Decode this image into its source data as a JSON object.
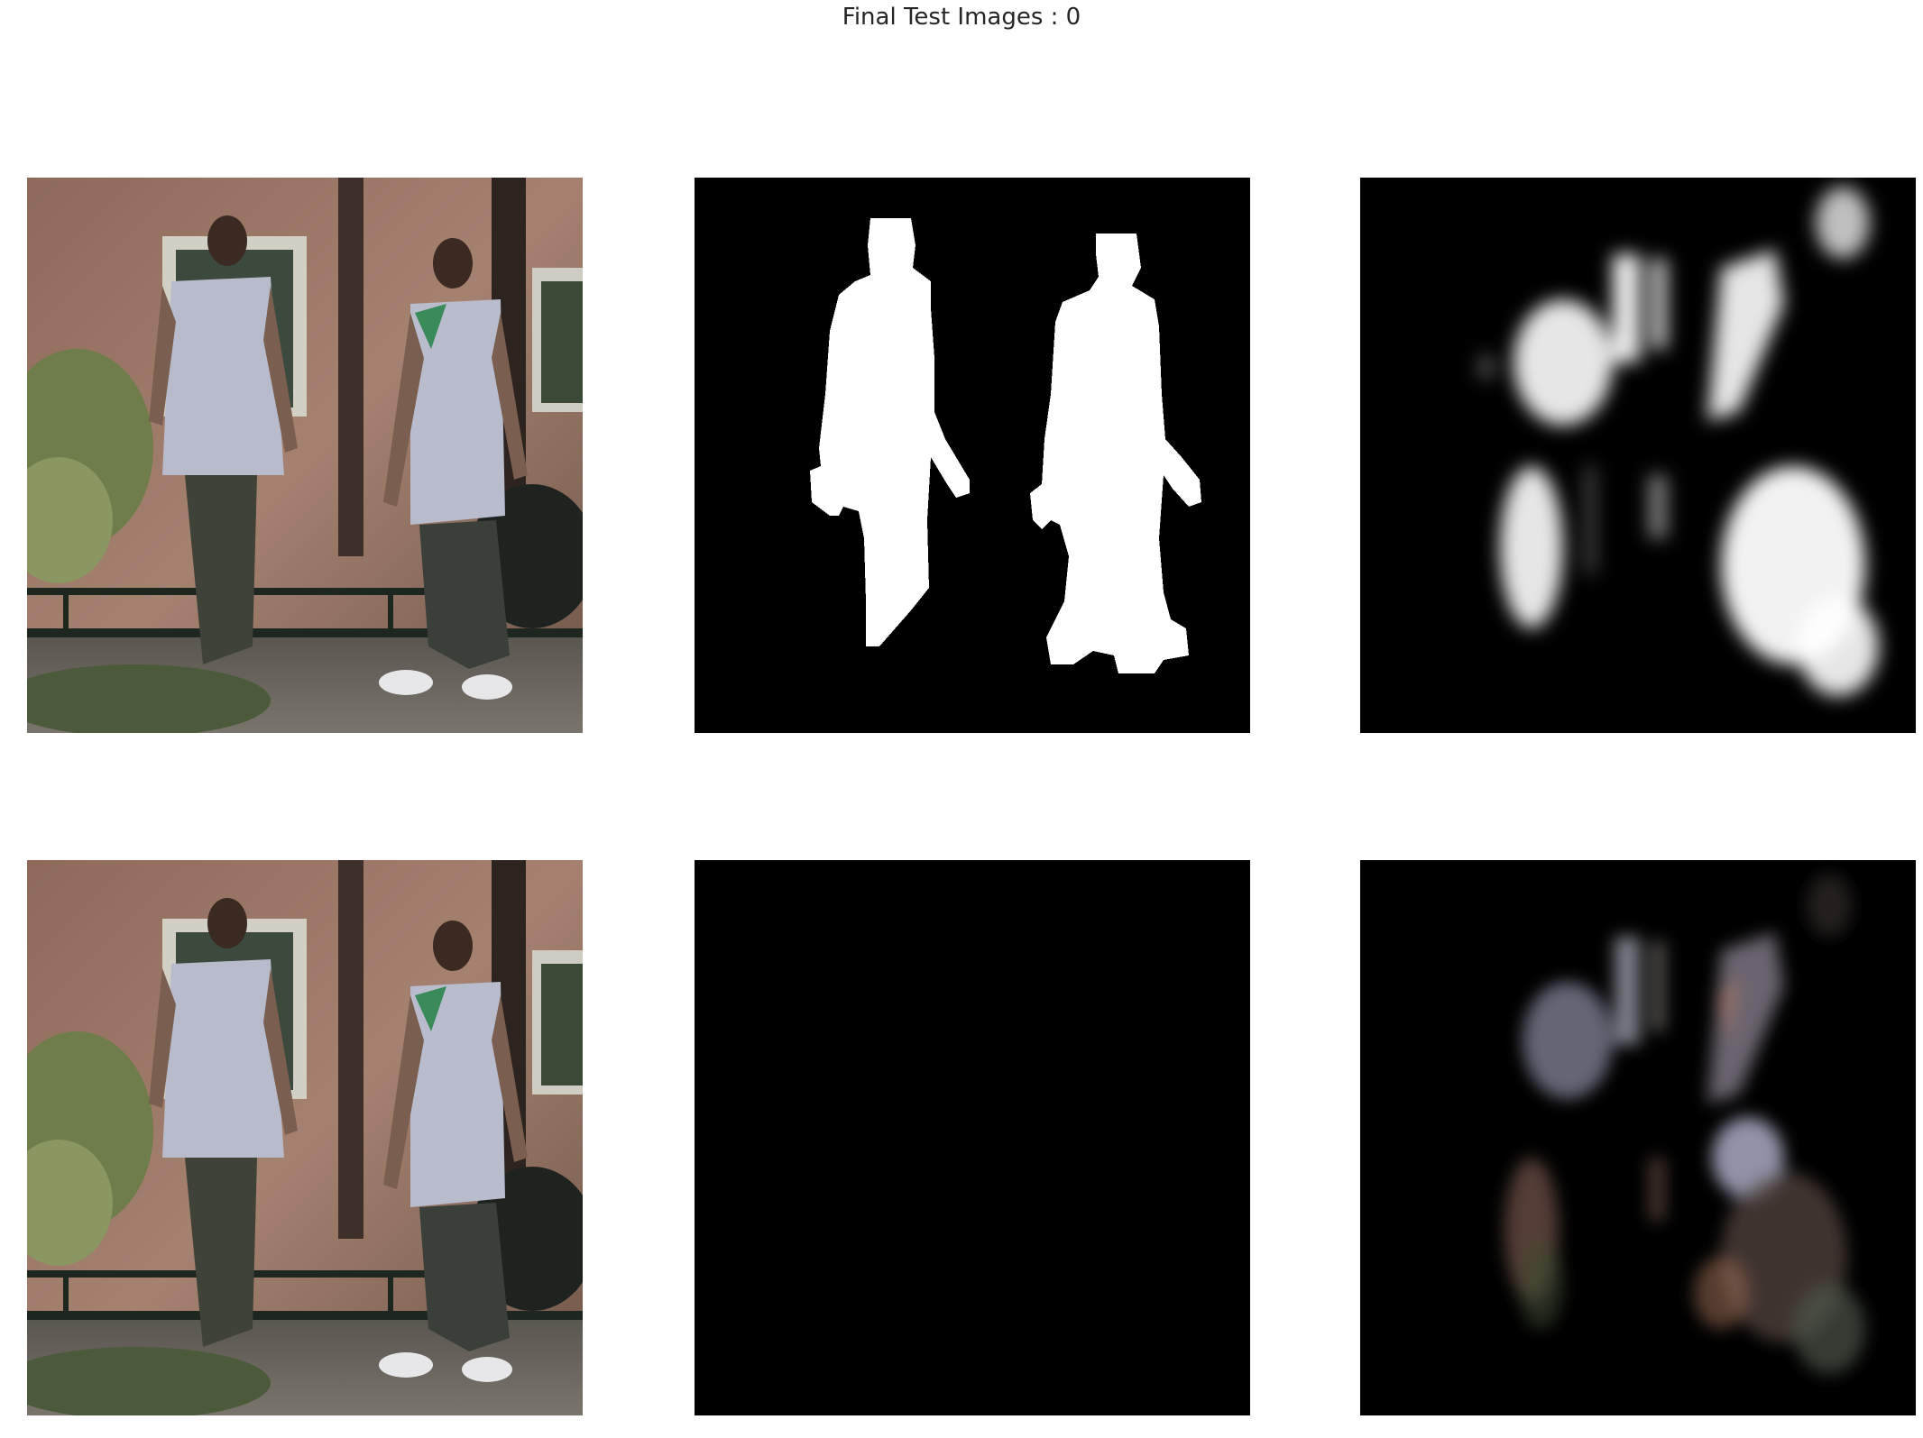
{
  "figure": {
    "title": "Final Test Images : 0"
  },
  "panels": [
    {
      "id": "input-image-row1",
      "kind": "photo"
    },
    {
      "id": "ground-truth-mask",
      "kind": "mask"
    },
    {
      "id": "predicted-mask",
      "kind": "soft-mask"
    },
    {
      "id": "input-image-row2",
      "kind": "photo"
    },
    {
      "id": "ground-truth-masked-image",
      "kind": "masked-photo"
    },
    {
      "id": "predicted-masked-image",
      "kind": "soft-masked-photo"
    }
  ],
  "colors": {
    "background": "#ffffff",
    "title_text": "#262626",
    "brick": "#9b7866",
    "shirt": "#b9bccd",
    "pants": "#3c3f38",
    "foliage": "#5d6d43",
    "mask_fg": "#ffffff",
    "mask_bg": "#000000"
  }
}
